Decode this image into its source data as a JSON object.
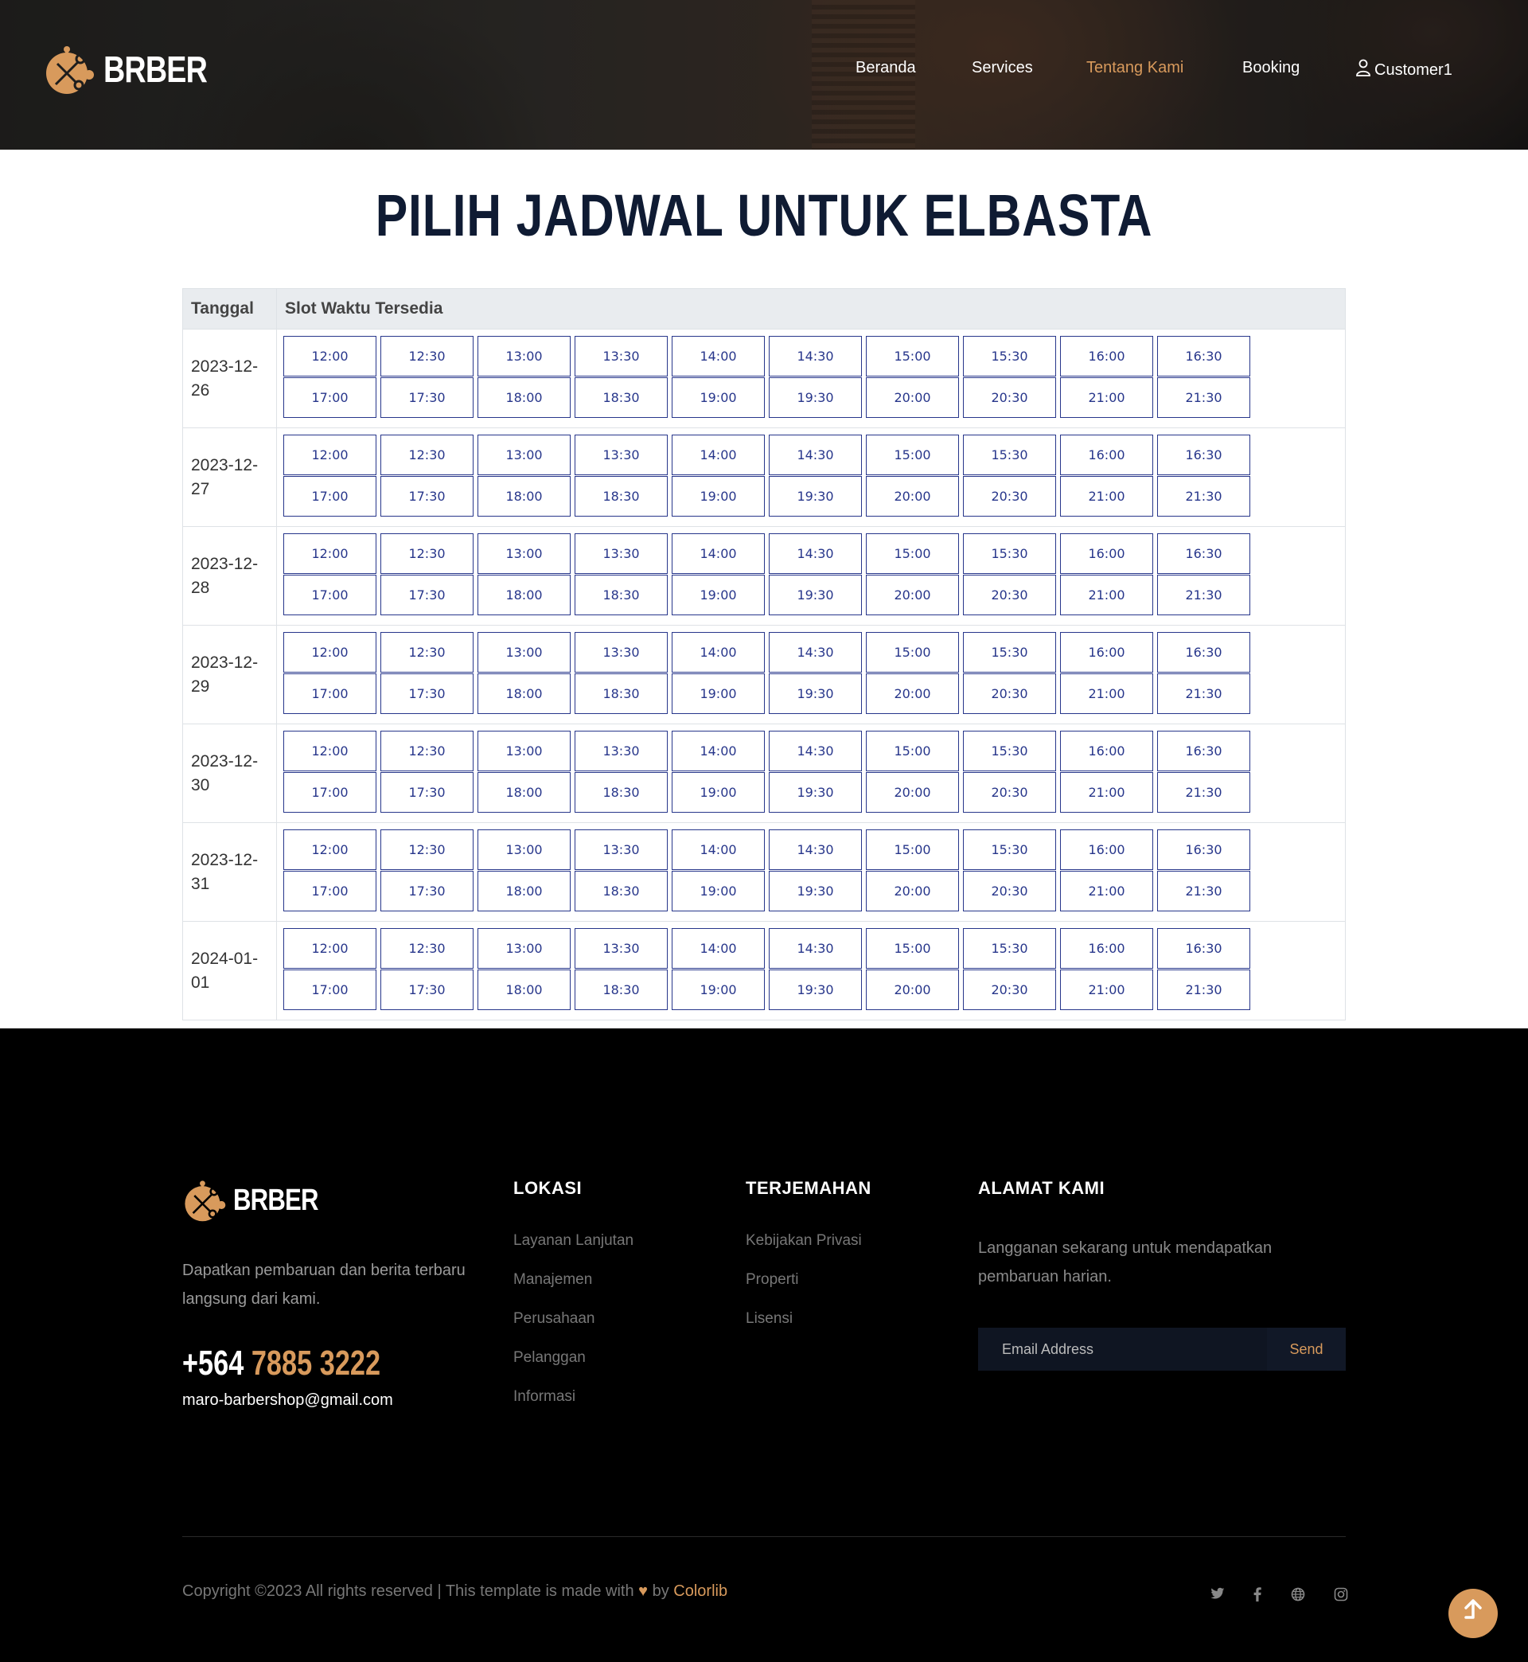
{
  "header": {
    "brand": "BRBER",
    "nav": [
      {
        "label": "Beranda",
        "active": false
      },
      {
        "label": "Services",
        "active": false
      },
      {
        "label": "Tentang Kami",
        "active": true
      },
      {
        "label": "Booking",
        "active": false
      },
      {
        "label": "Customer1",
        "active": false
      }
    ]
  },
  "page": {
    "title": "PILIH JADWAL UNTUK ELBASTA"
  },
  "schedule": {
    "headers": [
      "Tanggal",
      "Slot Waktu Tersedia"
    ],
    "rows": [
      {
        "date": "2023-12-26"
      },
      {
        "date": "2023-12-27"
      },
      {
        "date": "2023-12-28"
      },
      {
        "date": "2023-12-29"
      },
      {
        "date": "2023-12-30"
      },
      {
        "date": "2023-12-31"
      },
      {
        "date": "2024-01-01"
      }
    ],
    "slots_row1": [
      "12:00",
      "12:30",
      "13:00",
      "13:30",
      "14:00",
      "14:30",
      "15:00",
      "15:30",
      "16:00",
      "16:30"
    ],
    "slots_row2": [
      "17:00",
      "17:30",
      "18:00",
      "18:30",
      "19:00",
      "19:30",
      "20:00",
      "20:30",
      "21:00",
      "21:30"
    ]
  },
  "footer": {
    "brand": "BRBER",
    "about": "Dapatkan pembaruan dan berita terbaru langsung dari kami.",
    "phone_prefix": "+564",
    "phone_rest": "7885 3222",
    "email": "maro-barbershop@gmail.com",
    "col1_title": "LOKASI",
    "col1_links": [
      "Layanan Lanjutan",
      "Manajemen",
      "Perusahaan",
      "Pelanggan",
      "Informasi"
    ],
    "col2_title": "TERJEMAHAN",
    "col2_links": [
      "Kebijakan Privasi",
      "Properti",
      "Lisensi"
    ],
    "subscribe_title": "ALAMAT KAMI",
    "subscribe_text": "Langganan sekarang untuk mendapatkan pembaruan harian.",
    "email_placeholder": "Email Address",
    "send_label": "Send",
    "copyright_text": "Copyright ©2023 All rights reserved | This template is made with",
    "copyright_by": "by",
    "copyright_brand": "Colorlib",
    "socials": [
      "twitter-icon",
      "facebook-icon",
      "globe-icon",
      "instagram-icon"
    ]
  },
  "colors": {
    "accent": "#d89a5c",
    "slot_border": "#27368b",
    "title": "#0f1b33"
  }
}
